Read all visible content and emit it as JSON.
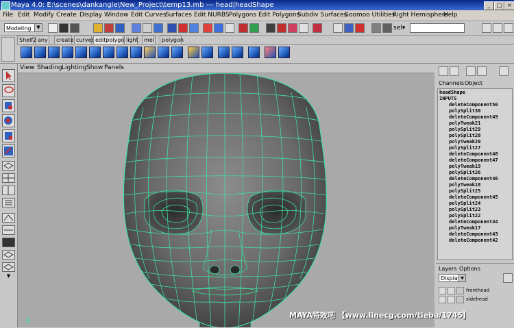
{
  "window": {
    "title": "Maya 4.0: E:\\scenes\\dankangle\\New_Project\\temp13.mb   ---   head|headShape",
    "min": "_",
    "max": "□",
    "close": "×"
  },
  "menubar": [
    "File",
    "Edit",
    "Modify",
    "Create",
    "Display",
    "Window",
    "Edit Curves",
    "Surfaces",
    "Edit NURBS",
    "Polygons",
    "Edit Polygons",
    "Subdiv Surfaces",
    "Goomoo Utilities",
    "Right Hemisphere",
    "Help"
  ],
  "statusline": {
    "mode": "Modeling",
    "sel_label": "sel▾"
  },
  "shelf": {
    "tabs": [
      "Shelf2",
      "any",
      "create",
      "curves",
      "editpolygon",
      "light",
      "mel",
      "polygon"
    ],
    "active_tab": "editpolygon"
  },
  "panel_menu": [
    "View",
    "Shading",
    "Lighting",
    "Show",
    "Panels"
  ],
  "channel_box": {
    "tabs": [
      "Channels",
      "Object"
    ],
    "node": "headShape",
    "section": "INPUTS",
    "inputs": [
      "deleteComponent50",
      "polySplit30",
      "deleteComponent49",
      "polyTweak21",
      "polySplit29",
      "polySplit28",
      "polyTweak20",
      "polySplit27",
      "deleteComponent48",
      "deleteComponent47",
      "polyTweak19",
      "polySplit26",
      "deleteComponent46",
      "polyTweak18",
      "polySplit25",
      "deleteComponent45",
      "polySplit24",
      "polySplit23",
      "polySplit22",
      "deleteComponent44",
      "polyTweak17",
      "deleteComponent43",
      "deleteComponent42"
    ]
  },
  "layers": {
    "tabs": [
      "Layers",
      "Options"
    ],
    "display": "Display",
    "items": [
      "fronthead",
      "sidehead"
    ]
  },
  "axis_label": "y",
  "watermark": "MAYA特效吧 【www.linecg.com/tieba/1745】",
  "colors": {
    "wire": "#3fe0a0",
    "viewport_bg": "#a9a9a9",
    "title_bar": "#0a2a8a"
  }
}
